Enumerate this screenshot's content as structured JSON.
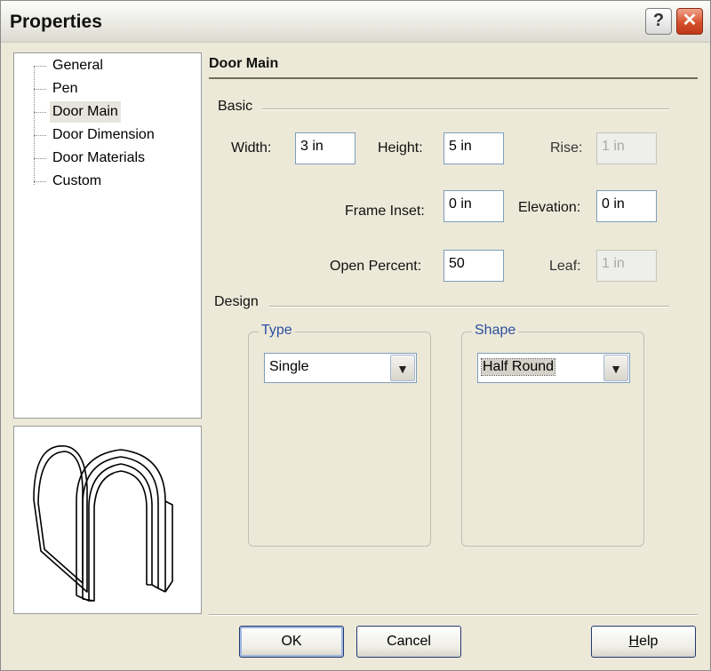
{
  "window": {
    "title": "Properties",
    "help_glyph": "?",
    "close_glyph": "✕"
  },
  "tree": {
    "items": [
      {
        "label": "General"
      },
      {
        "label": "Pen"
      },
      {
        "label": "Door Main",
        "selected": true
      },
      {
        "label": "Door Dimension"
      },
      {
        "label": "Door Materials"
      },
      {
        "label": "Custom"
      }
    ]
  },
  "panel": {
    "heading": "Door Main",
    "basic": {
      "label": "Basic",
      "width_label": "Width:",
      "width_value": "3 in",
      "height_label": "Height:",
      "height_value": "5 in",
      "rise_label": "Rise:",
      "rise_value": "1 in",
      "frame_inset_label": "Frame Inset:",
      "frame_inset_value": "0 in",
      "elevation_label": "Elevation:",
      "elevation_value": "0 in",
      "open_percent_label": "Open Percent:",
      "open_percent_value": "50",
      "leaf_label": "Leaf:",
      "leaf_value": "1 in"
    },
    "design": {
      "label": "Design",
      "type_label": "Type",
      "type_value": "Single",
      "shape_label": "Shape",
      "shape_value": "Half Round"
    }
  },
  "buttons": {
    "ok": "OK",
    "cancel": "Cancel",
    "help_h": "H",
    "help_rest": "elp"
  },
  "icons": {
    "dropdown": "chevron-down-icon",
    "preview": "door-preview-icon"
  },
  "colors": {
    "group_label": "#2c4fa1",
    "dialog_bg": "#ece9d8",
    "close_button": "#d7502c"
  }
}
